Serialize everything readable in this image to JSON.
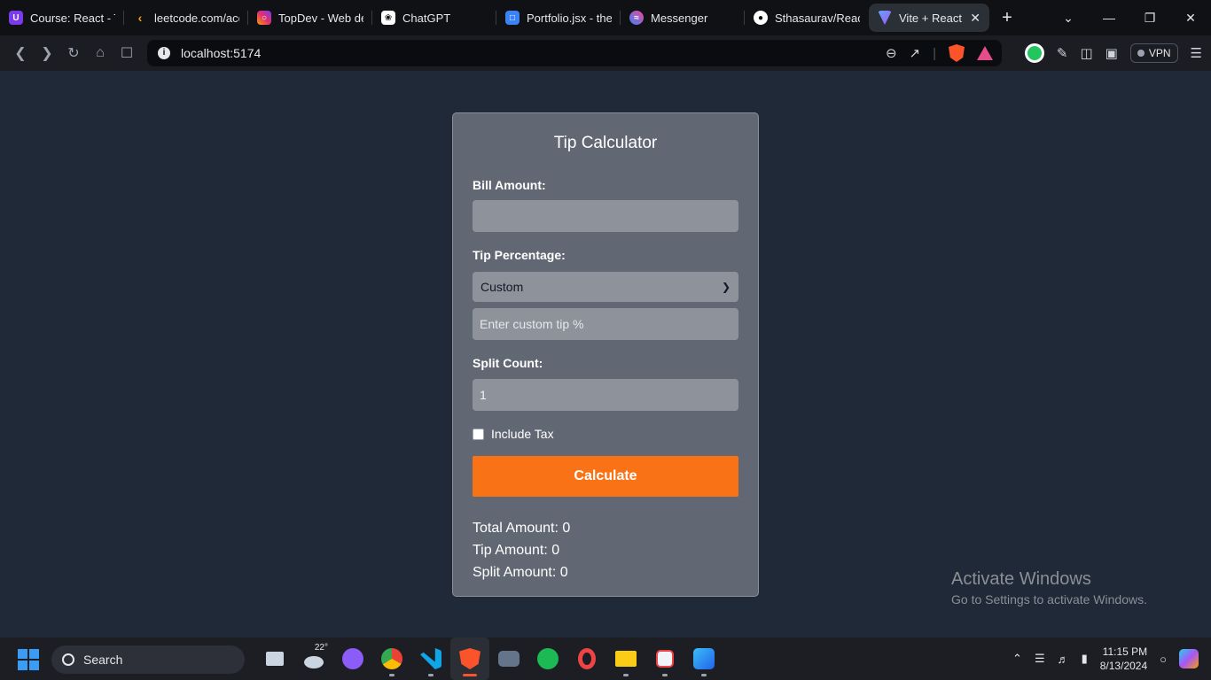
{
  "browser": {
    "tabs": [
      {
        "title": "Course: React - Tl",
        "color": "#7c3aed",
        "icon": "udemy-icon"
      },
      {
        "title": "leetcode.com/acc",
        "color": "#f59e0b",
        "icon": "leetcode-icon"
      },
      {
        "title": "TopDev - Web de",
        "color": "#e1306c",
        "icon": "instagram-icon"
      },
      {
        "title": "ChatGPT",
        "color": "#ffffff",
        "icon": "chatgpt-icon"
      },
      {
        "title": "Portfolio.jsx - the",
        "color": "#3b82f6",
        "icon": "codesandbox-icon"
      },
      {
        "title": "Messenger",
        "color": "#8b5cf6",
        "icon": "messenger-icon"
      },
      {
        "title": "Sthasaurav/React",
        "color": "#ffffff",
        "icon": "github-icon"
      },
      {
        "title": "Vite + React",
        "color": "#a855f7",
        "icon": "vite-icon",
        "active": true
      }
    ],
    "url": "localhost:5174",
    "vpn_label": "VPN"
  },
  "app": {
    "title": "Tip Calculator",
    "bill_label": "Bill Amount:",
    "bill_value": "",
    "tip_label": "Tip Percentage:",
    "tip_selected": "Custom",
    "custom_tip_placeholder": "Enter custom tip %",
    "split_label": "Split Count:",
    "split_value": "1",
    "include_tax_label": "Include Tax",
    "include_tax_checked": false,
    "calculate_label": "Calculate",
    "results": {
      "total": "Total Amount: 0",
      "tip": "Tip Amount: 0",
      "split": "Split Amount: 0"
    }
  },
  "watermark": {
    "line1": "Activate Windows",
    "line2": "Go to Settings to activate Windows."
  },
  "taskbar": {
    "search_label": "Search",
    "weather_temp": "22°",
    "time": "11:15 PM",
    "date": "8/13/2024"
  }
}
